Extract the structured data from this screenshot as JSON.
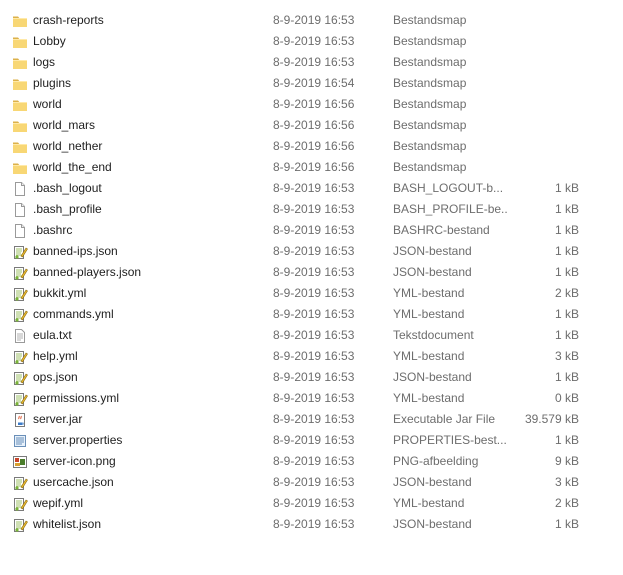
{
  "files": [
    {
      "name": "crash-reports",
      "date": "8-9-2019 16:53",
      "type": "Bestandsmap",
      "size": "",
      "icon": "folder-icon"
    },
    {
      "name": "Lobby",
      "date": "8-9-2019 16:53",
      "type": "Bestandsmap",
      "size": "",
      "icon": "folder-icon"
    },
    {
      "name": "logs",
      "date": "8-9-2019 16:53",
      "type": "Bestandsmap",
      "size": "",
      "icon": "folder-icon"
    },
    {
      "name": "plugins",
      "date": "8-9-2019 16:54",
      "type": "Bestandsmap",
      "size": "",
      "icon": "folder-icon"
    },
    {
      "name": "world",
      "date": "8-9-2019 16:56",
      "type": "Bestandsmap",
      "size": "",
      "icon": "folder-icon"
    },
    {
      "name": "world_mars",
      "date": "8-9-2019 16:56",
      "type": "Bestandsmap",
      "size": "",
      "icon": "folder-icon"
    },
    {
      "name": "world_nether",
      "date": "8-9-2019 16:56",
      "type": "Bestandsmap",
      "size": "",
      "icon": "folder-icon"
    },
    {
      "name": "world_the_end",
      "date": "8-9-2019 16:56",
      "type": "Bestandsmap",
      "size": "",
      "icon": "folder-icon"
    },
    {
      "name": ".bash_logout",
      "date": "8-9-2019 16:53",
      "type": "BASH_LOGOUT-b...",
      "size": "1 kB",
      "icon": "blank-file-icon"
    },
    {
      "name": ".bash_profile",
      "date": "8-9-2019 16:53",
      "type": "BASH_PROFILE-be...",
      "size": "1 kB",
      "icon": "blank-file-icon"
    },
    {
      "name": ".bashrc",
      "date": "8-9-2019 16:53",
      "type": "BASHRC-bestand",
      "size": "1 kB",
      "icon": "blank-file-icon"
    },
    {
      "name": "banned-ips.json",
      "date": "8-9-2019 16:53",
      "type": "JSON-bestand",
      "size": "1 kB",
      "icon": "notepad-plus-file-icon"
    },
    {
      "name": "banned-players.json",
      "date": "8-9-2019 16:53",
      "type": "JSON-bestand",
      "size": "1 kB",
      "icon": "notepad-plus-file-icon"
    },
    {
      "name": "bukkit.yml",
      "date": "8-9-2019 16:53",
      "type": "YML-bestand",
      "size": "2 kB",
      "icon": "notepad-plus-file-icon"
    },
    {
      "name": "commands.yml",
      "date": "8-9-2019 16:53",
      "type": "YML-bestand",
      "size": "1 kB",
      "icon": "notepad-plus-file-icon"
    },
    {
      "name": "eula.txt",
      "date": "8-9-2019 16:53",
      "type": "Tekstdocument",
      "size": "1 kB",
      "icon": "text-document-icon"
    },
    {
      "name": "help.yml",
      "date": "8-9-2019 16:53",
      "type": "YML-bestand",
      "size": "3 kB",
      "icon": "notepad-plus-file-icon"
    },
    {
      "name": "ops.json",
      "date": "8-9-2019 16:53",
      "type": "JSON-bestand",
      "size": "1 kB",
      "icon": "notepad-plus-file-icon"
    },
    {
      "name": "permissions.yml",
      "date": "8-9-2019 16:53",
      "type": "YML-bestand",
      "size": "0 kB",
      "icon": "notepad-plus-file-icon"
    },
    {
      "name": "server.jar",
      "date": "8-9-2019 16:53",
      "type": "Executable Jar File",
      "size": "39.579 kB",
      "icon": "java-jar-icon"
    },
    {
      "name": "server.properties",
      "date": "8-9-2019 16:53",
      "type": "PROPERTIES-best...",
      "size": "1 kB",
      "icon": "properties-file-icon"
    },
    {
      "name": "server-icon.png",
      "date": "8-9-2019 16:53",
      "type": "PNG-afbeelding",
      "size": "9 kB",
      "icon": "image-file-icon"
    },
    {
      "name": "usercache.json",
      "date": "8-9-2019 16:53",
      "type": "JSON-bestand",
      "size": "3 kB",
      "icon": "notepad-plus-file-icon"
    },
    {
      "name": "wepif.yml",
      "date": "8-9-2019 16:53",
      "type": "YML-bestand",
      "size": "2 kB",
      "icon": "notepad-plus-file-icon"
    },
    {
      "name": "whitelist.json",
      "date": "8-9-2019 16:53",
      "type": "JSON-bestand",
      "size": "1 kB",
      "icon": "notepad-plus-file-icon"
    }
  ],
  "colors": {
    "folder": "#f8d775",
    "folder_dark": "#dcb14a",
    "secondary_text": "#6d6d6d",
    "hover": "#e5f3ff"
  }
}
